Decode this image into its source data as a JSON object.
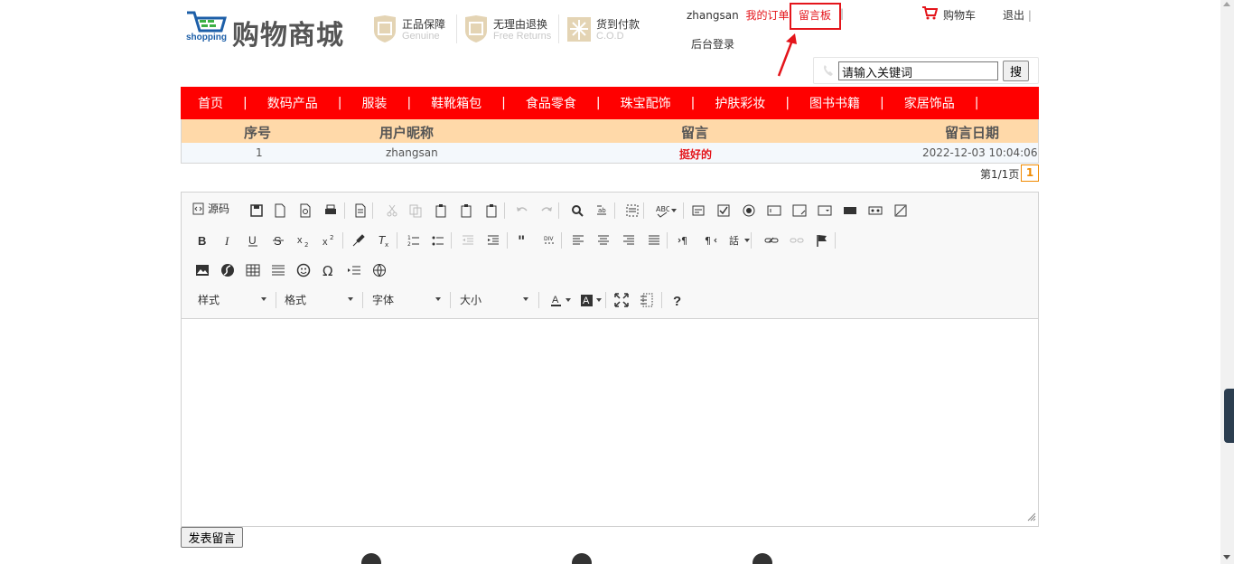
{
  "header": {
    "brand": "购物商城",
    "brand_sub": "shopping",
    "guarantees": [
      {
        "title": "正品保障",
        "sub": "Genuine",
        "icon": "genuine-shield-icon"
      },
      {
        "title": "无理由退换",
        "sub": "Free Returns",
        "icon": "returns-shield-icon"
      },
      {
        "title": "货到付款",
        "sub": "C.O.D",
        "icon": "cod-box-icon"
      }
    ],
    "username": "zhangsan",
    "my_orders": "我的订单",
    "message_board": "留言板",
    "separator": "|",
    "admin_login": "后台登录",
    "cart": "购物车",
    "logout": "退出",
    "search_value": "请输入关键词",
    "search_btn": "搜"
  },
  "nav": {
    "items": [
      "首页",
      "数码产品",
      "服装",
      "鞋靴箱包",
      "食品零食",
      "珠宝配饰",
      "护肤彩妆",
      "图书书籍",
      "家居饰品"
    ],
    "separator": "|"
  },
  "table": {
    "headers": [
      "序号",
      "用户昵称",
      "留言",
      "留言日期"
    ],
    "rows": [
      {
        "id": "1",
        "nick": "zhangsan",
        "message": "挺好的",
        "date": "2022-12-03 10:04:06"
      }
    ]
  },
  "pager": {
    "text": "第1/1页",
    "current": "1"
  },
  "editor": {
    "source_label": "源码",
    "combos": [
      "样式",
      "格式",
      "字体",
      "大小"
    ],
    "submit": "发表留言"
  },
  "colors": {
    "accent": "#ff0000",
    "table_head": "#ffd9a9",
    "link_red": "#e4151b",
    "pager": "#f08a00"
  }
}
